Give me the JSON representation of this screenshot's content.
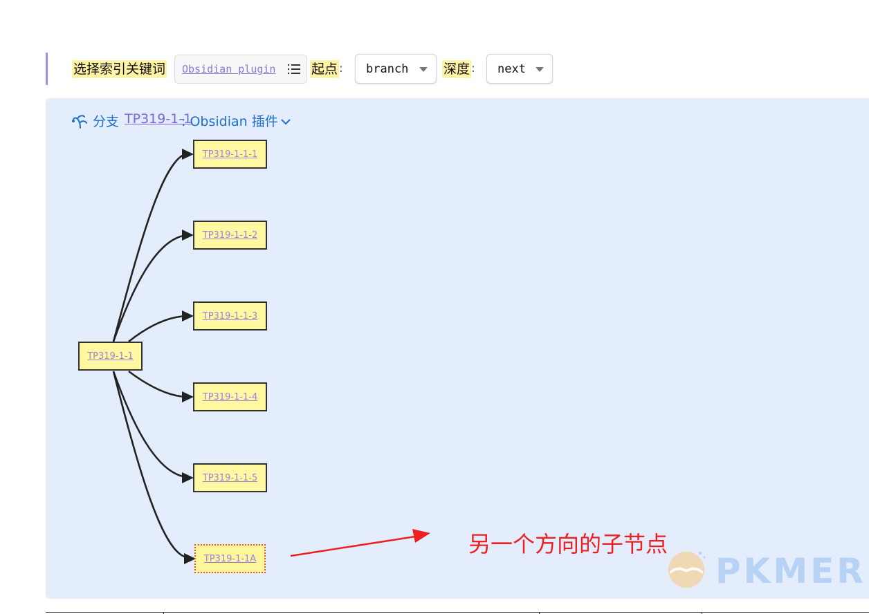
{
  "toolbar": {
    "keyword_label": "选择索引关键词",
    "keyword_value": "Obsidian plugin",
    "start_label": "起点",
    "start_value": "branch",
    "depth_label": "深度",
    "depth_value": "next",
    "colon": ":"
  },
  "panel": {
    "prefix": "分支",
    "link": "TP319-1-1",
    "title": ": Obsidian 插件"
  },
  "graph": {
    "root": "TP319-1-1",
    "children": [
      "TP319-1-1-1",
      "TP319-1-1-2",
      "TP319-1-1-3",
      "TP319-1-1-4",
      "TP319-1-1-5",
      "TP319-1-1A"
    ]
  },
  "annotation": "另一个方向的子节点",
  "logo_text": "PKMER",
  "colors": {
    "panel_bg": "#e3edfb",
    "highlight": "#fff3a8",
    "node_fill": "#fff8a0",
    "link": "#7d67d8",
    "heading": "#1c6fd0",
    "annotation": "#ec2020"
  }
}
